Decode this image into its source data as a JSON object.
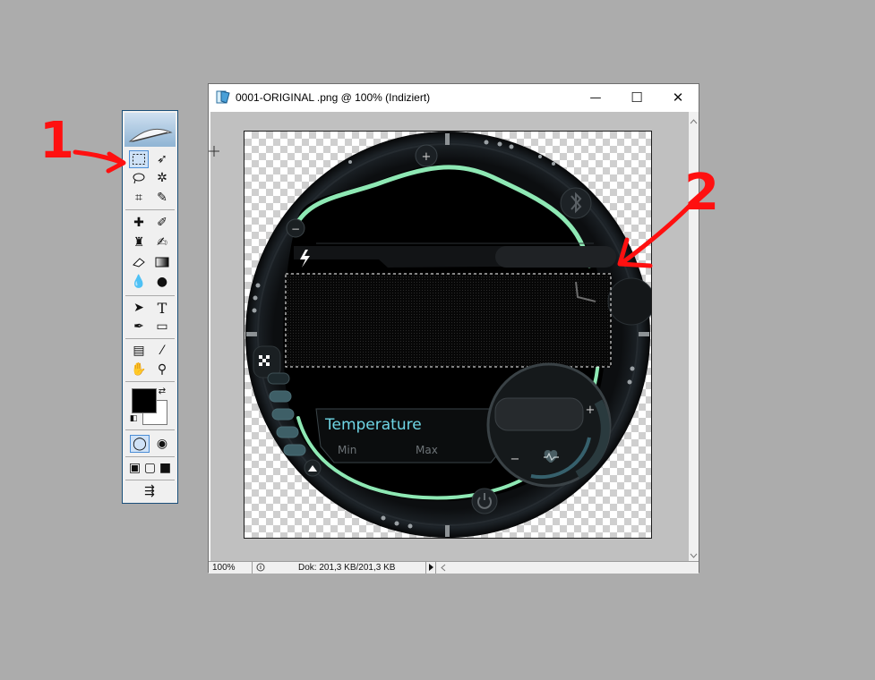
{
  "window": {
    "title": "0001-ORIGINAL .png @ 100% (Indiziert)",
    "minimize_glyph": "—",
    "maximize_glyph": "☐",
    "close_glyph": "✕"
  },
  "statusbar": {
    "zoom": "100%",
    "doc_info": "Dok: 201,3 KB/201,3 KB"
  },
  "watchface": {
    "temperature_label": "Temperature",
    "min_label": "Min",
    "max_label": "Max",
    "plus_top": "+",
    "plus_right": "+",
    "minus_left": "−",
    "minus_bottom": "−",
    "accent_color": "#8ee8b4",
    "text_color": "#6fd6e6"
  },
  "annotations": {
    "label_1": "1",
    "label_2": "2",
    "color": "#ff1010"
  },
  "toolbox": {
    "icons": [
      "marquee-rect-icon",
      "move-icon",
      "lasso-icon",
      "magic-wand-icon",
      "crop-icon",
      "slice-icon",
      "healing-brush-icon",
      "brush-icon",
      "clone-stamp-icon",
      "history-brush-icon",
      "eraser-icon",
      "gradient-icon",
      "blur-icon",
      "dodge-icon",
      "path-select-icon",
      "type-icon",
      "pen-icon",
      "shape-icon",
      "notes-icon",
      "eyedropper-icon",
      "hand-icon",
      "zoom-icon"
    ],
    "foreground_color": "#000000",
    "background_color": "#ffffff"
  }
}
